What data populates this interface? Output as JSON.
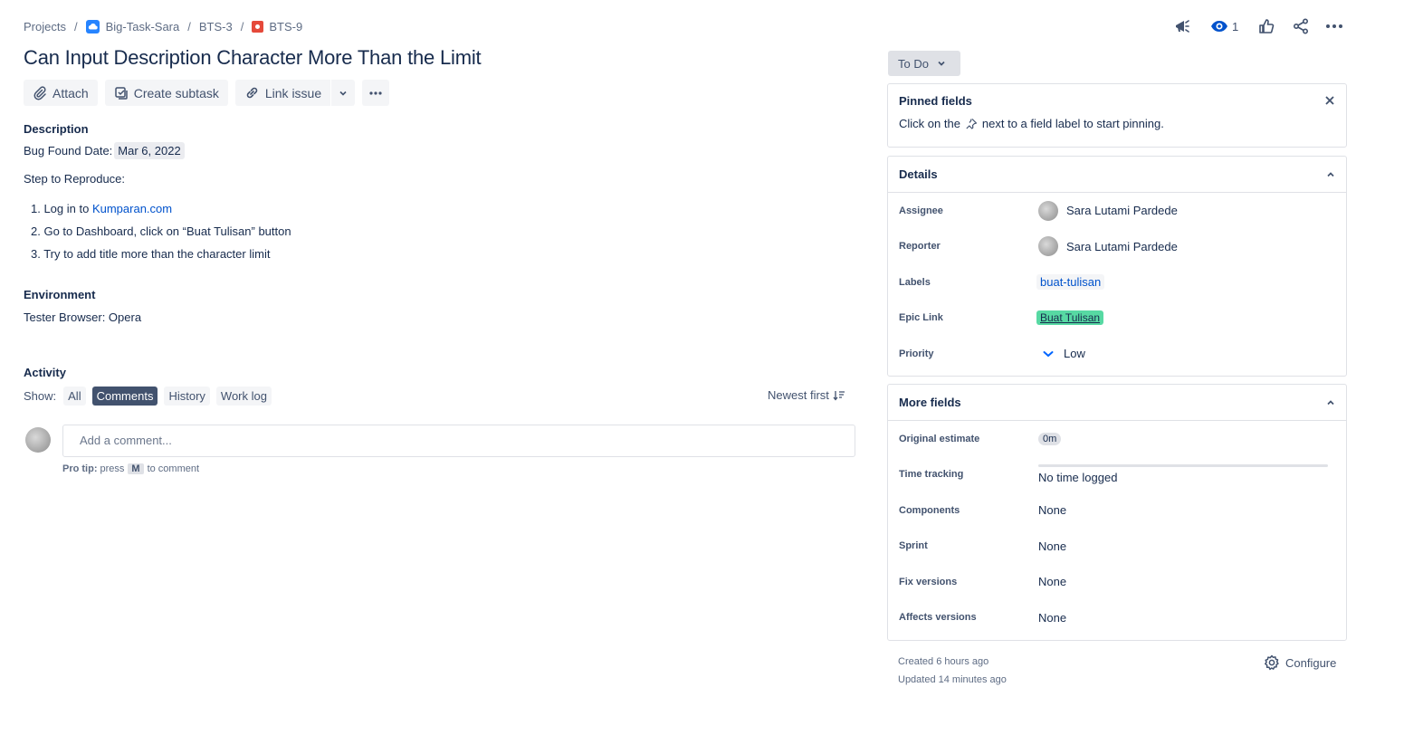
{
  "breadcrumb": {
    "projects": "Projects",
    "project": "Big-Task-Sara",
    "parent": "BTS-3",
    "issue": "BTS-9",
    "sep": "/"
  },
  "header": {
    "watch_count": "1"
  },
  "title": "Can Input Description Character More Than the Limit",
  "toolbar": {
    "attach": "Attach",
    "create_subtask": "Create subtask",
    "link_issue": "Link issue"
  },
  "description": {
    "label": "Description",
    "bug_date_label": "Bug Found Date:",
    "bug_date_value": "Mar 6, 2022",
    "steps_label": "Step to Reproduce:",
    "step1_prefix": "1. Log in to ",
    "step1_link": "Kumparan.com",
    "step2": "2. Go to Dashboard, click on “Buat Tulisan” button",
    "step3": "3. Try to add title more than the character limit"
  },
  "environment": {
    "label": "Environment",
    "value": "Tester Browser: Opera"
  },
  "activity": {
    "label": "Activity",
    "show_label": "Show:",
    "filters": [
      "All",
      "Comments",
      "History",
      "Work log"
    ],
    "active_filter": "Comments",
    "sort": "Newest first",
    "comment_placeholder": "Add a comment...",
    "protip_bold": "Pro tip:",
    "protip_press": "press",
    "protip_key": "M",
    "protip_rest": "to comment"
  },
  "status": {
    "label": "To Do"
  },
  "pinned": {
    "title": "Pinned fields",
    "hint_before": "Click on the",
    "hint_after": "next to a field label to start pinning."
  },
  "details": {
    "title": "Details",
    "assignee_label": "Assignee",
    "assignee": "Sara Lutami Pardede",
    "reporter_label": "Reporter",
    "reporter": "Sara Lutami Pardede",
    "labels_label": "Labels",
    "labels_value": "buat-tulisan",
    "epic_label": "Epic Link",
    "epic_value": "Buat Tulisan",
    "priority_label": "Priority",
    "priority_value": "Low"
  },
  "more_fields": {
    "title": "More fields",
    "original_estimate_label": "Original estimate",
    "original_estimate_value": "0m",
    "time_tracking_label": "Time tracking",
    "time_tracking_value": "No time logged",
    "components_label": "Components",
    "components_value": "None",
    "sprint_label": "Sprint",
    "sprint_value": "None",
    "fix_versions_label": "Fix versions",
    "fix_versions_value": "None",
    "affects_versions_label": "Affects versions",
    "affects_versions_value": "None"
  },
  "footer": {
    "created": "Created 6 hours ago",
    "updated": "Updated 14 minutes ago",
    "configure": "Configure"
  },
  "colors": {
    "link": "#0052cc",
    "epic": "#57d9a3",
    "bug": "#e5493a",
    "priority_low": "#0065ff"
  }
}
